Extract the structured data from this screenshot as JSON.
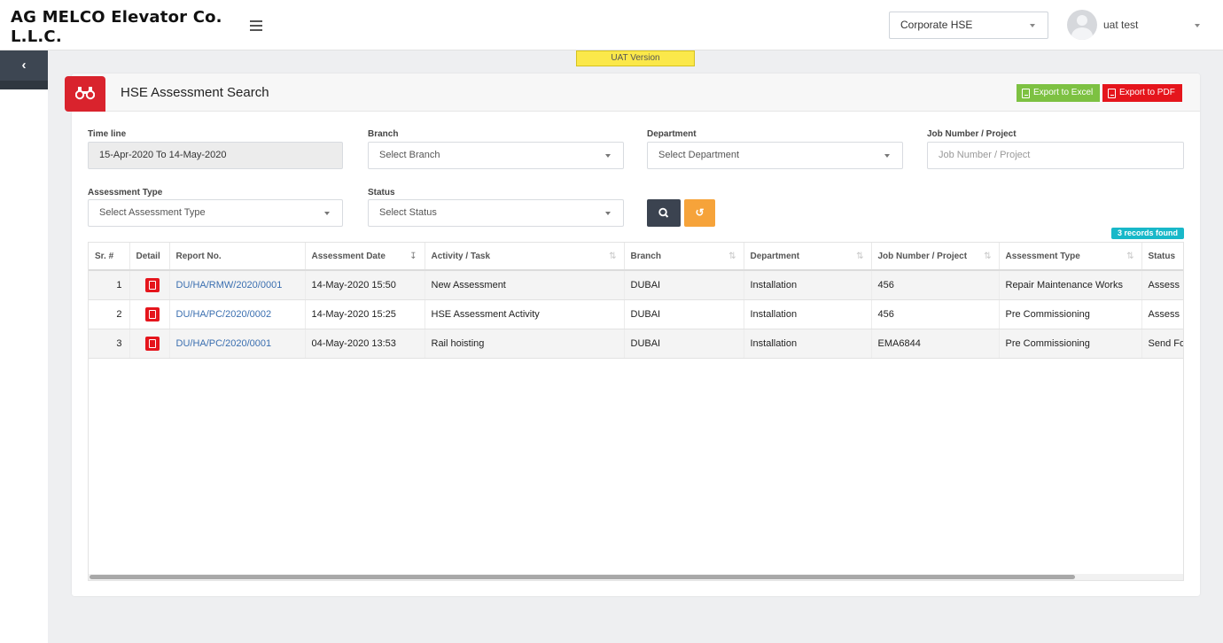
{
  "header": {
    "brand_line1": "AG MELCO Elevator Co.",
    "brand_line2": "L.L.C.",
    "role_selected": "Corporate HSE",
    "user_name": "uat test"
  },
  "uat_badge": "UAT Version",
  "panel": {
    "title": "HSE Assessment Search",
    "export_excel": "Export to Excel",
    "export_pdf": "Export to PDF",
    "excel_color": "#7dc142",
    "pdf_color": "#e5151c",
    "icon": "binoculars-icon"
  },
  "filters": {
    "timeline_label": "Time line",
    "timeline_value": "15-Apr-2020 To 14-May-2020",
    "branch_label": "Branch",
    "branch_placeholder": "Select Branch",
    "department_label": "Department",
    "department_placeholder": "Select Department",
    "job_label": "Job Number / Project",
    "job_placeholder": "Job Number / Project",
    "assessment_type_label": "Assessment Type",
    "assessment_type_placeholder": "Select Assessment Type",
    "status_label": "Status",
    "status_placeholder": "Select Status",
    "reset_glyph": "↺"
  },
  "records_found": "3 records found",
  "table": {
    "columns": [
      "Sr. #",
      "Detail",
      "Report No.",
      "Assessment Date",
      "Activity / Task",
      "Branch",
      "Department",
      "Job Number / Project",
      "Assessment Type",
      "Status"
    ],
    "rows": [
      {
        "sr": "1",
        "report": "DU/HA/RMW/2020/0001",
        "date": "14-May-2020 15:50",
        "activity": "New Assessment",
        "branch": "DUBAI",
        "department": "Installation",
        "job": "456",
        "type": "Repair Maintenance Works",
        "status": "Assess"
      },
      {
        "sr": "2",
        "report": "DU/HA/PC/2020/0002",
        "date": "14-May-2020 15:25",
        "activity": "HSE Assessment Activity",
        "branch": "DUBAI",
        "department": "Installation",
        "job": "456",
        "type": "Pre Commissioning",
        "status": "Assess"
      },
      {
        "sr": "3",
        "report": "DU/HA/PC/2020/0001",
        "date": "04-May-2020 13:53",
        "activity": "Rail hoisting",
        "branch": "DUBAI",
        "department": "Installation",
        "job": "EMA6844",
        "type": "Pre Commissioning",
        "status": "Send Fo"
      }
    ]
  }
}
